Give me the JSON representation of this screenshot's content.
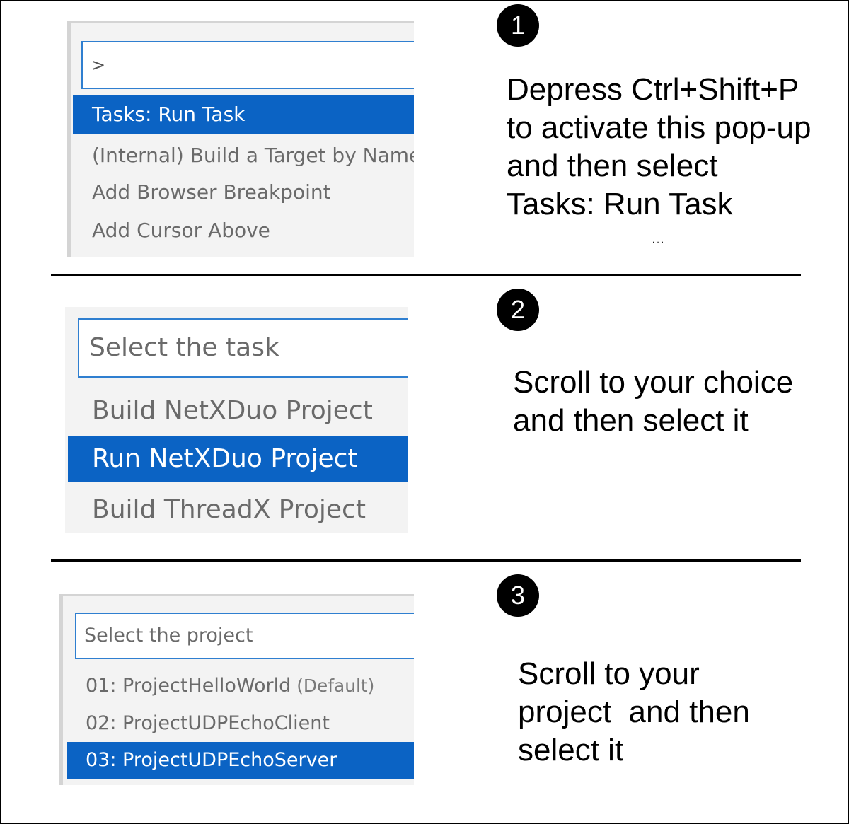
{
  "steps": [
    {
      "number": "1",
      "input_value": ">",
      "items": [
        {
          "label": "Tasks: Run Task",
          "selected": true
        },
        {
          "label": "(Internal) Build a Target by Name",
          "selected": false
        },
        {
          "label": "Add Browser Breakpoint",
          "selected": false
        },
        {
          "label": "Add Cursor Above",
          "selected": false
        }
      ],
      "instruction_lines": [
        "Depress Ctrl+Shift+P",
        "to activate this pop-up",
        "and then select",
        "Tasks: Run Task"
      ],
      "ellipsis": "..."
    },
    {
      "number": "2",
      "input_placeholder": "Select the task",
      "items": [
        {
          "label": "Build NetXDuo Project",
          "selected": false
        },
        {
          "label": "Run NetXDuo Project",
          "selected": true
        },
        {
          "label": "Build ThreadX Project",
          "selected": false
        }
      ],
      "instruction_lines": [
        "Scroll to your choice",
        "and then select it"
      ]
    },
    {
      "number": "3",
      "input_placeholder": "Select the project",
      "items": [
        {
          "label": "01: ProjectHelloWorld",
          "hint": "(Default)",
          "selected": false
        },
        {
          "label": "02: ProjectUDPEchoClient",
          "selected": false
        },
        {
          "label": "03: ProjectUDPEchoServer",
          "selected": true
        }
      ],
      "instruction_lines": [
        "Scroll to your",
        "project  and then",
        "select it"
      ]
    }
  ],
  "colors": {
    "selection": "#0b63c4",
    "input_border": "#2f7fd0",
    "panel_bg": "#f3f3f3"
  }
}
